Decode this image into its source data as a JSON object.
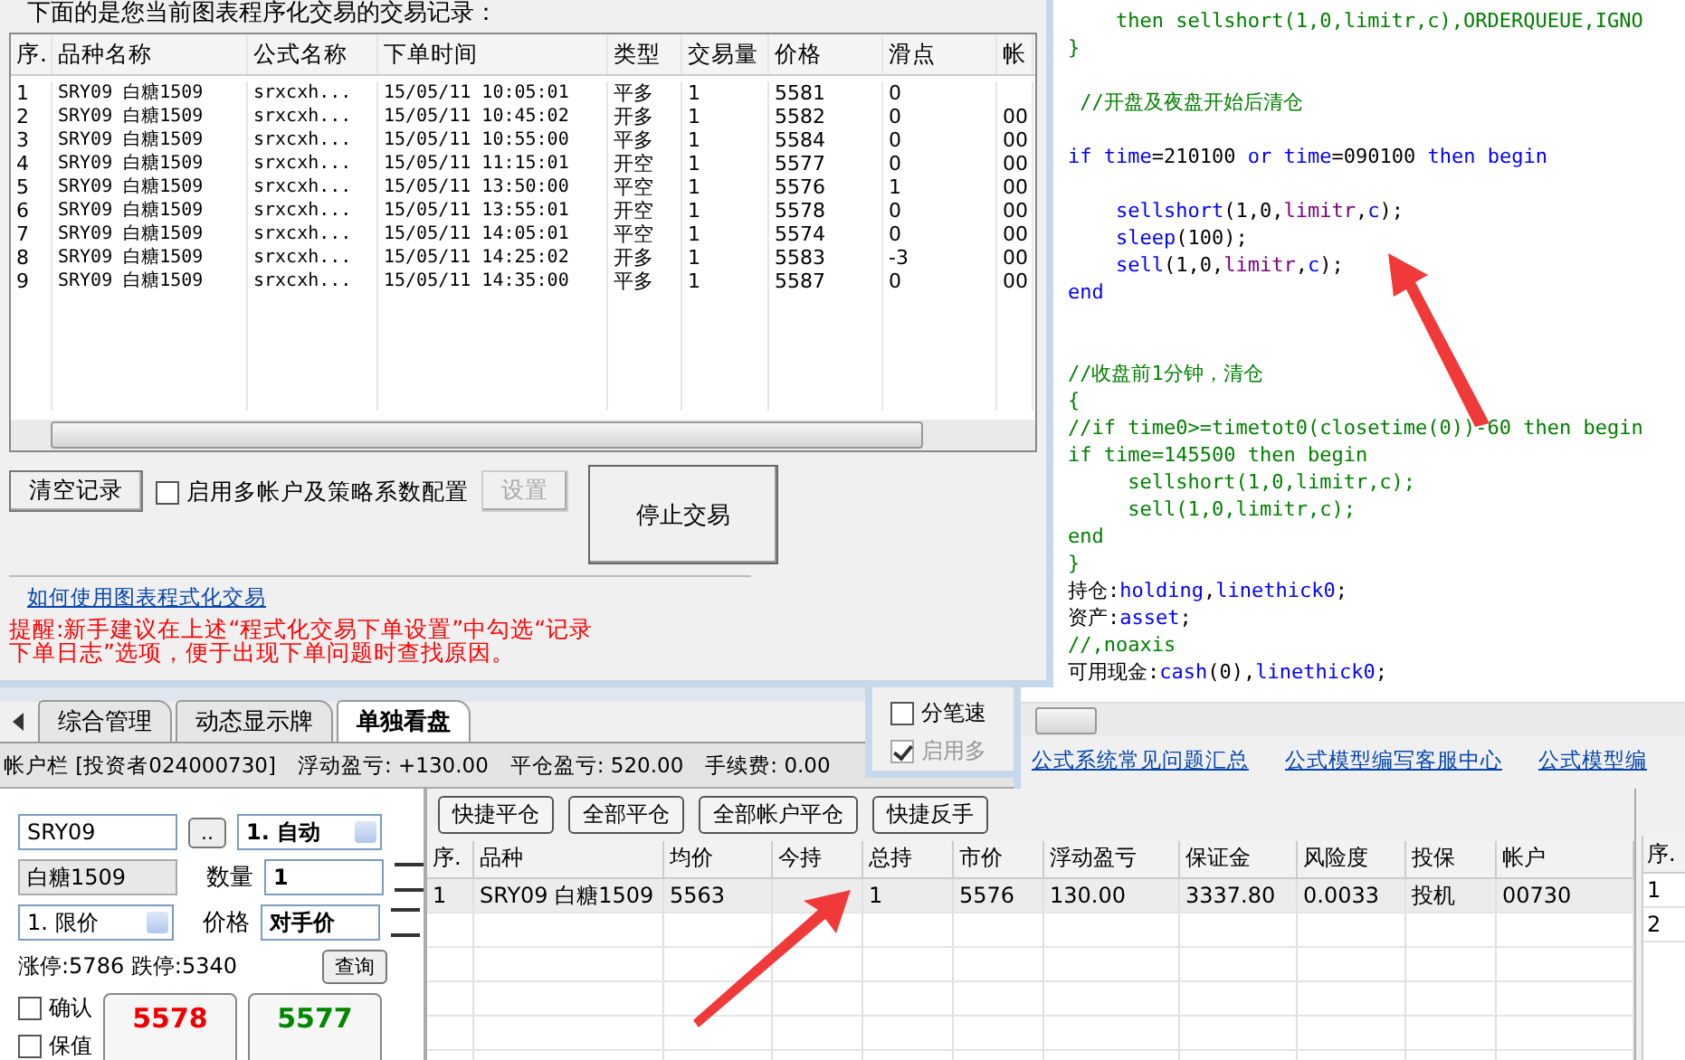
{
  "trade_dialog": {
    "caption": "下面的是您当前图表程序化交易的交易记录：",
    "columns": [
      "序.",
      "品种名称",
      "公式名称",
      "下单时间",
      "类型",
      "交易量",
      "价格",
      "滑点",
      "帐"
    ],
    "rows": [
      [
        "1",
        "SRY09 白糖1509",
        "srxcxh...",
        "15/05/11 10:05:01",
        "平多",
        "1",
        "5581",
        "0",
        ""
      ],
      [
        "2",
        "SRY09 白糖1509",
        "srxcxh...",
        "15/05/11 10:45:02",
        "开多",
        "1",
        "5582",
        "0",
        "00"
      ],
      [
        "3",
        "SRY09 白糖1509",
        "srxcxh...",
        "15/05/11 10:55:00",
        "平多",
        "1",
        "5584",
        "0",
        "00"
      ],
      [
        "4",
        "SRY09 白糖1509",
        "srxcxh...",
        "15/05/11 11:15:01",
        "开空",
        "1",
        "5577",
        "0",
        "00"
      ],
      [
        "5",
        "SRY09 白糖1509",
        "srxcxh...",
        "15/05/11 13:50:00",
        "平空",
        "1",
        "5576",
        "1",
        "00"
      ],
      [
        "6",
        "SRY09 白糖1509",
        "srxcxh...",
        "15/05/11 13:55:01",
        "开空",
        "1",
        "5578",
        "0",
        "00"
      ],
      [
        "7",
        "SRY09 白糖1509",
        "srxcxh...",
        "15/05/11 14:05:01",
        "平空",
        "1",
        "5574",
        "0",
        "00"
      ],
      [
        "8",
        "SRY09 白糖1509",
        "srxcxh...",
        "15/05/11 14:25:02",
        "开多",
        "1",
        "5583",
        "-3",
        "00"
      ],
      [
        "9",
        "SRY09 白糖1509",
        "srxcxh...",
        "15/05/11 14:35:00",
        "平多",
        "1",
        "5587",
        "0",
        "00"
      ]
    ],
    "clear_button": "清空记录",
    "multi_account": {
      "label": "启用多帐户及策略系数配置",
      "checked": false
    },
    "settings_button": {
      "label": "设置",
      "disabled": true
    },
    "stop_button": "停止交易",
    "help_link": "如何使用图表程式化交易",
    "reminder": "提醒:新手建议在上述“程式化交易下单设置”中勾选“记录下单日志”选项，便于出现下单问题时查找原因。"
  },
  "options_dialog": {
    "checkboxes": [
      {
        "label": "分笔速",
        "checked": false,
        "disabled": false
      },
      {
        "label": "启用多",
        "checked": true,
        "disabled": true
      }
    ]
  },
  "editor": {
    "lines": [
      {
        "kind": "code",
        "segments": [
          {
            "text": "    then sellshort(1,0,limitr,c),ORDERQUEUE,IGNO",
            "kind": "comment"
          }
        ]
      },
      {
        "kind": "code",
        "segments": [
          {
            "text": "}",
            "kind": "comment"
          }
        ]
      },
      {
        "kind": "blank"
      },
      {
        "kind": "code",
        "segments": [
          {
            "text": " //开盘及夜盘开始后清仓",
            "kind": "comment"
          }
        ]
      },
      {
        "kind": "blank"
      },
      {
        "kind": "code",
        "segments": [
          {
            "text": "if",
            "kind": "keyword"
          },
          {
            "text": " time",
            "kind": "keyword"
          },
          {
            "text": "=210100 ",
            "kind": "plain"
          },
          {
            "text": "or",
            "kind": "keyword"
          },
          {
            "text": " time",
            "kind": "keyword"
          },
          {
            "text": "=090100 ",
            "kind": "plain"
          },
          {
            "text": "then begin",
            "kind": "keyword"
          }
        ]
      },
      {
        "kind": "blank"
      },
      {
        "kind": "code",
        "segments": [
          {
            "text": "    sellshort",
            "kind": "keyword"
          },
          {
            "text": "(1,0,",
            "kind": "plain"
          },
          {
            "text": "limitr",
            "kind": "param"
          },
          {
            "text": ",",
            "kind": "plain"
          },
          {
            "text": "c",
            "kind": "keyword"
          },
          {
            "text": ");",
            "kind": "plain"
          }
        ]
      },
      {
        "kind": "code",
        "segments": [
          {
            "text": "    sleep",
            "kind": "keyword"
          },
          {
            "text": "(100);",
            "kind": "plain"
          }
        ]
      },
      {
        "kind": "code",
        "segments": [
          {
            "text": "    sell",
            "kind": "keyword"
          },
          {
            "text": "(1,0,",
            "kind": "plain"
          },
          {
            "text": "limitr",
            "kind": "param"
          },
          {
            "text": ",",
            "kind": "plain"
          },
          {
            "text": "c",
            "kind": "keyword"
          },
          {
            "text": ");",
            "kind": "plain"
          }
        ]
      },
      {
        "kind": "code",
        "segments": [
          {
            "text": "end",
            "kind": "keyword"
          }
        ]
      },
      {
        "kind": "blank"
      },
      {
        "kind": "blank"
      },
      {
        "kind": "code",
        "segments": [
          {
            "text": "//收盘前1分钟，清仓",
            "kind": "comment"
          }
        ]
      },
      {
        "kind": "code",
        "segments": [
          {
            "text": "{",
            "kind": "comment"
          }
        ]
      },
      {
        "kind": "code",
        "segments": [
          {
            "text": "//if time0>=timetot0(closetime(0))-60 then begin",
            "kind": "comment"
          }
        ]
      },
      {
        "kind": "code",
        "segments": [
          {
            "text": "if time=145500 then begin",
            "kind": "comment"
          }
        ]
      },
      {
        "kind": "code",
        "segments": [
          {
            "text": "     sellshort(1,0,limitr,c);",
            "kind": "comment"
          }
        ]
      },
      {
        "kind": "code",
        "segments": [
          {
            "text": "     sell(1,0,limitr,c);",
            "kind": "comment"
          }
        ]
      },
      {
        "kind": "code",
        "segments": [
          {
            "text": "end",
            "kind": "comment"
          }
        ]
      },
      {
        "kind": "code",
        "segments": [
          {
            "text": "}",
            "kind": "comment"
          }
        ]
      },
      {
        "kind": "code",
        "segments": [
          {
            "text": "持仓:",
            "kind": "plain"
          },
          {
            "text": "holding",
            "kind": "keyword"
          },
          {
            "text": ",",
            "kind": "plain"
          },
          {
            "text": "linethick0",
            "kind": "keyword"
          },
          {
            "text": ";",
            "kind": "plain"
          }
        ]
      },
      {
        "kind": "code",
        "segments": [
          {
            "text": "资产:",
            "kind": "plain"
          },
          {
            "text": "asset",
            "kind": "keyword"
          },
          {
            "text": ";",
            "kind": "plain"
          }
        ]
      },
      {
        "kind": "code",
        "segments": [
          {
            "text": "//,noaxis",
            "kind": "comment"
          }
        ]
      },
      {
        "kind": "code",
        "segments": [
          {
            "text": "可用现金:",
            "kind": "plain"
          },
          {
            "text": "cash",
            "kind": "keyword"
          },
          {
            "text": "(0),",
            "kind": "plain"
          },
          {
            "text": "linethick0",
            "kind": "keyword"
          },
          {
            "text": ";",
            "kind": "plain"
          }
        ]
      }
    ],
    "links": [
      "公式系统常见问题汇总",
      "公式模型编写客服中心",
      "公式模型编"
    ]
  },
  "tabs": [
    {
      "label": "综合管理",
      "selected": false
    },
    {
      "label": "动态显示牌",
      "selected": false
    },
    {
      "label": "单独看盘",
      "selected": true
    }
  ],
  "account_bar": [
    "帐户栏 [投资者024000730]",
    "浮动盈亏: +130.00",
    "平仓盈亏: 520.00",
    "手续费: 0.00"
  ],
  "order_panel": {
    "code": "SRY09",
    "browse_button": "..",
    "mode": "1. 自动",
    "name": "白糖1509",
    "qty_label": "数量",
    "qty": "1",
    "price_type": "1. 限价",
    "price_label": "价格",
    "price": "对手价",
    "limits": "涨停:5786 跌停:5340",
    "query_button": "查询",
    "checkboxes": [
      {
        "label": "确认",
        "checked": false
      },
      {
        "label": "保值",
        "checked": false
      }
    ],
    "buy_price": "5578",
    "sell_price": "5577"
  },
  "positions": {
    "buttons": [
      "快捷平仓",
      "全部平仓",
      "全部帐户平仓",
      "快捷反手"
    ],
    "columns": [
      "序.",
      "品种",
      "均价",
      "今持",
      "总持",
      "市价",
      "浮动盈亏",
      "保证金",
      "风险度",
      "投保",
      "帐户"
    ],
    "rows": [
      {
        "cells": [
          "1",
          "SRY09 白糖1509",
          "5563",
          "",
          "1",
          "5576",
          "130.00",
          "3337.80",
          "0.0033",
          "投机",
          "00730"
        ],
        "selected": true
      }
    ]
  },
  "side_table": {
    "column": "序.",
    "rows": [
      "1",
      "2"
    ]
  }
}
